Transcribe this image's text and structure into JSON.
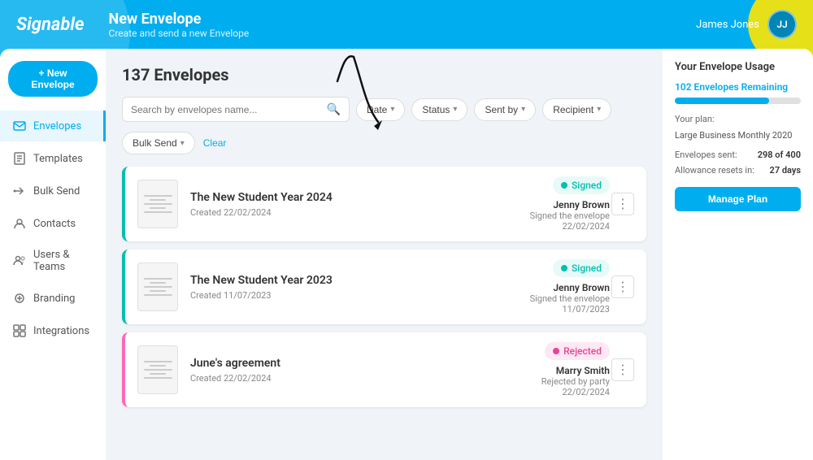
{
  "header": {
    "logo": "Signable",
    "title": "New Envelope",
    "subtitle": "Create and send a new Envelope",
    "user_name": "James Jones",
    "user_initials": "JJ"
  },
  "sidebar": {
    "new_envelope_label": "+ New Envelope",
    "items": [
      {
        "id": "envelopes",
        "label": "Envelopes",
        "active": true
      },
      {
        "id": "templates",
        "label": "Templates",
        "active": false
      },
      {
        "id": "bulk-send",
        "label": "Bulk Send",
        "active": false
      },
      {
        "id": "contacts",
        "label": "Contacts",
        "active": false
      },
      {
        "id": "users-teams",
        "label": "Users & Teams",
        "active": false
      },
      {
        "id": "branding",
        "label": "Branding",
        "active": false
      },
      {
        "id": "integrations",
        "label": "Integrations",
        "active": false
      }
    ]
  },
  "main": {
    "envelope_count": "137 Envelopes",
    "search_placeholder": "Search by envelopes name...",
    "filters": [
      {
        "label": "Date"
      },
      {
        "label": "Status"
      },
      {
        "label": "Sent by"
      },
      {
        "label": "Recipient"
      }
    ],
    "bulk_send_label": "Bulk Send",
    "clear_label": "Clear",
    "envelopes": [
      {
        "id": 1,
        "name": "The New Student Year 2024",
        "created": "Created 22/02/2024",
        "status": "Signed",
        "status_type": "signed",
        "recipient_name": "Jenny Brown",
        "recipient_action": "Signed the envelope",
        "recipient_date": "22/02/2024"
      },
      {
        "id": 2,
        "name": "The New Student Year 2023",
        "created": "Created 11/07/2023",
        "status": "Signed",
        "status_type": "signed",
        "recipient_name": "Jenny Brown",
        "recipient_action": "Signed the envelope",
        "recipient_date": "11/07/2023"
      },
      {
        "id": 3,
        "name": "June's agreement",
        "created": "Created 22/02/2024",
        "status": "Rejected",
        "status_type": "rejected",
        "recipient_name": "Marry Smith",
        "recipient_action": "Rejected by party",
        "recipient_date": "22/02/2024"
      }
    ]
  },
  "usage": {
    "title": "Your Envelope Usage",
    "remaining_label": "102 Envelopes Remaining",
    "progress_percent": 75,
    "envelopes_sent_label": "Envelopes sent:",
    "envelopes_sent_value": "298 of 400",
    "allowance_label": "Allowance resets in:",
    "allowance_value": "27 days",
    "plan_label": "Your plan:",
    "plan_value": "Large Business Monthly 2020",
    "manage_plan_label": "Manage Plan"
  }
}
